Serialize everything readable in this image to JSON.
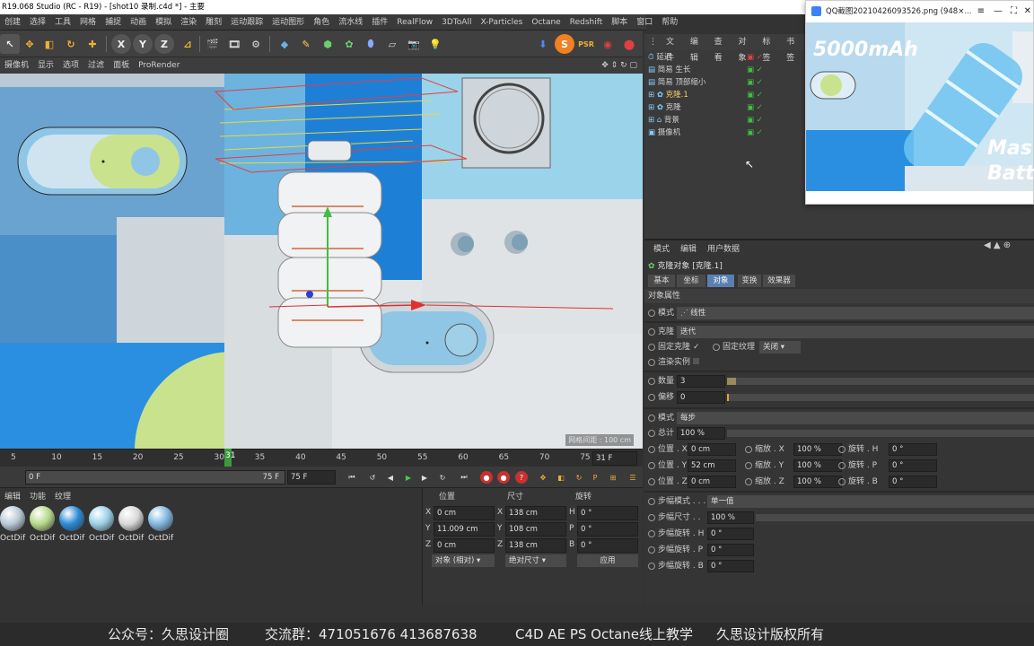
{
  "window": {
    "title": "R19.068 Studio (RC - R19) - [shot10 录制.c4d *] - 主要"
  },
  "menubar": [
    "创建",
    "选择",
    "工具",
    "网格",
    "捕捉",
    "动画",
    "模拟",
    "渲染",
    "雕刻",
    "运动跟踪",
    "运动图形",
    "角色",
    "流水线",
    "插件",
    "RealFlow",
    "3DToAll",
    "X-Particles",
    "Octane",
    "Redshift",
    "脚本",
    "窗口",
    "帮助"
  ],
  "toolbar": {
    "x": "X",
    "y": "Y",
    "z": "Z"
  },
  "viewport_menu": [
    "摄像机",
    "显示",
    "选项",
    "过滤",
    "面板",
    "ProRender"
  ],
  "viewport": {
    "info": "网格间距 : 100 cm"
  },
  "timeline": {
    "ticks": [
      "5",
      "10",
      "15",
      "20",
      "25",
      "30",
      "35",
      "40",
      "45",
      "50",
      "55",
      "60",
      "65",
      "70",
      "75"
    ],
    "current_frame": "31",
    "end_field": "31 F"
  },
  "playbar": {
    "start": "0 F",
    "end_range": "75 F",
    "end_field": "75 F"
  },
  "material_menu": [
    "编辑",
    "功能",
    "纹理"
  ],
  "materials": [
    {
      "label": "OctDif",
      "color": "#b9c9d6"
    },
    {
      "label": "OctDif",
      "color": "#b7d98a"
    },
    {
      "label": "OctDif",
      "color": "#2a8ad4"
    },
    {
      "label": "OctDif",
      "color": "#9ad0e8"
    },
    {
      "label": "OctDif",
      "color": "#d8d8d8"
    },
    {
      "label": "OctDif",
      "color": "#7fb8e0"
    }
  ],
  "coords": {
    "headers": {
      "position": "位置",
      "size": "尺寸",
      "rotation": "旋转"
    },
    "rows": [
      {
        "axis": "X",
        "pos": "0 cm",
        "saxis": "X",
        "size": "138 cm",
        "raxis": "H",
        "rot": "0 °"
      },
      {
        "axis": "Y",
        "pos": "11.009 cm",
        "saxis": "Y",
        "size": "108 cm",
        "raxis": "P",
        "rot": "0 °"
      },
      {
        "axis": "Z",
        "pos": "0 cm",
        "saxis": "Z",
        "size": "138 cm",
        "raxis": "B",
        "rot": "0 °"
      }
    ],
    "mode": "对象 (相对)",
    "size_mode": "绝对尺寸",
    "apply": "应用"
  },
  "object_manager": {
    "menu": [
      "文件",
      "编辑",
      "查看",
      "对象",
      "标签",
      "书签"
    ],
    "objects": [
      {
        "name": "延迟",
        "color": "#cfcfcf"
      },
      {
        "name": "简易 生长",
        "color": "#cfcfcf"
      },
      {
        "name": "简易 顶部缩小",
        "color": "#cfcfcf"
      },
      {
        "name": "克隆.1",
        "color": "#f0d060"
      },
      {
        "name": "克隆",
        "color": "#cfcfcf"
      },
      {
        "name": "背景",
        "color": "#cfcfcf"
      },
      {
        "name": "摄像机",
        "color": "#cfcfcf"
      }
    ]
  },
  "qq_window": {
    "title": "QQ截图20210426093526.png (948×...",
    "headline": "5000mAh",
    "side_text1": "Mas",
    "side_text2": "Batt"
  },
  "attributes": {
    "menu": [
      "模式",
      "编辑",
      "用户数据"
    ],
    "object_title": "克隆对象 [克隆.1]",
    "tabs": [
      "基本",
      "坐标",
      "对象",
      "变换",
      "效果器"
    ],
    "active_tab": 2,
    "section": "对象属性",
    "mode_label": "模式",
    "mode_value": "线性",
    "clone_label": "克隆",
    "clone_value": "迭代",
    "fix_clone": "固定克隆",
    "fix_texture": "固定纹理",
    "fix_texture_value": "关闭",
    "render_instances": "渲染实例",
    "count_label": "数量",
    "count_value": "3",
    "offset_label": "偏移",
    "offset_value": "0",
    "mode2_label": "模式",
    "mode2_value": "每步",
    "total_label": "总计",
    "total_value": "100 %",
    "transform": [
      {
        "p_label": "位置 . X",
        "p_val": "0 cm",
        "s_label": "缩放 . X",
        "s_val": "100 %",
        "r_label": "旋转 . H",
        "r_val": "0 °"
      },
      {
        "p_label": "位置 . Y",
        "p_val": "52 cm",
        "s_label": "缩放 . Y",
        "s_val": "100 %",
        "r_label": "旋转 . P",
        "r_val": "0 °"
      },
      {
        "p_label": "位置 . Z",
        "p_val": "0 cm",
        "s_label": "缩放 . Z",
        "s_val": "100 %",
        "r_label": "旋转 . B",
        "r_val": "0 °"
      }
    ],
    "step_mode_label": "步幅模式",
    "step_mode_value": "单一值",
    "step_size_label": "步幅尺寸",
    "step_size_value": "100 %",
    "step_rot": [
      {
        "label": "步幅旋转 . H",
        "value": "0 °"
      },
      {
        "label": "步幅旋转 . P",
        "value": "0 °"
      },
      {
        "label": "步幅旋转 . B",
        "value": "0 °"
      }
    ]
  },
  "footer": {
    "wechat": "公众号：久思设计圈",
    "group": "交流群：471051676   413687638",
    "course": "C4D AE PS Octane线上教学",
    "copyright": "久思设计版权所有"
  }
}
